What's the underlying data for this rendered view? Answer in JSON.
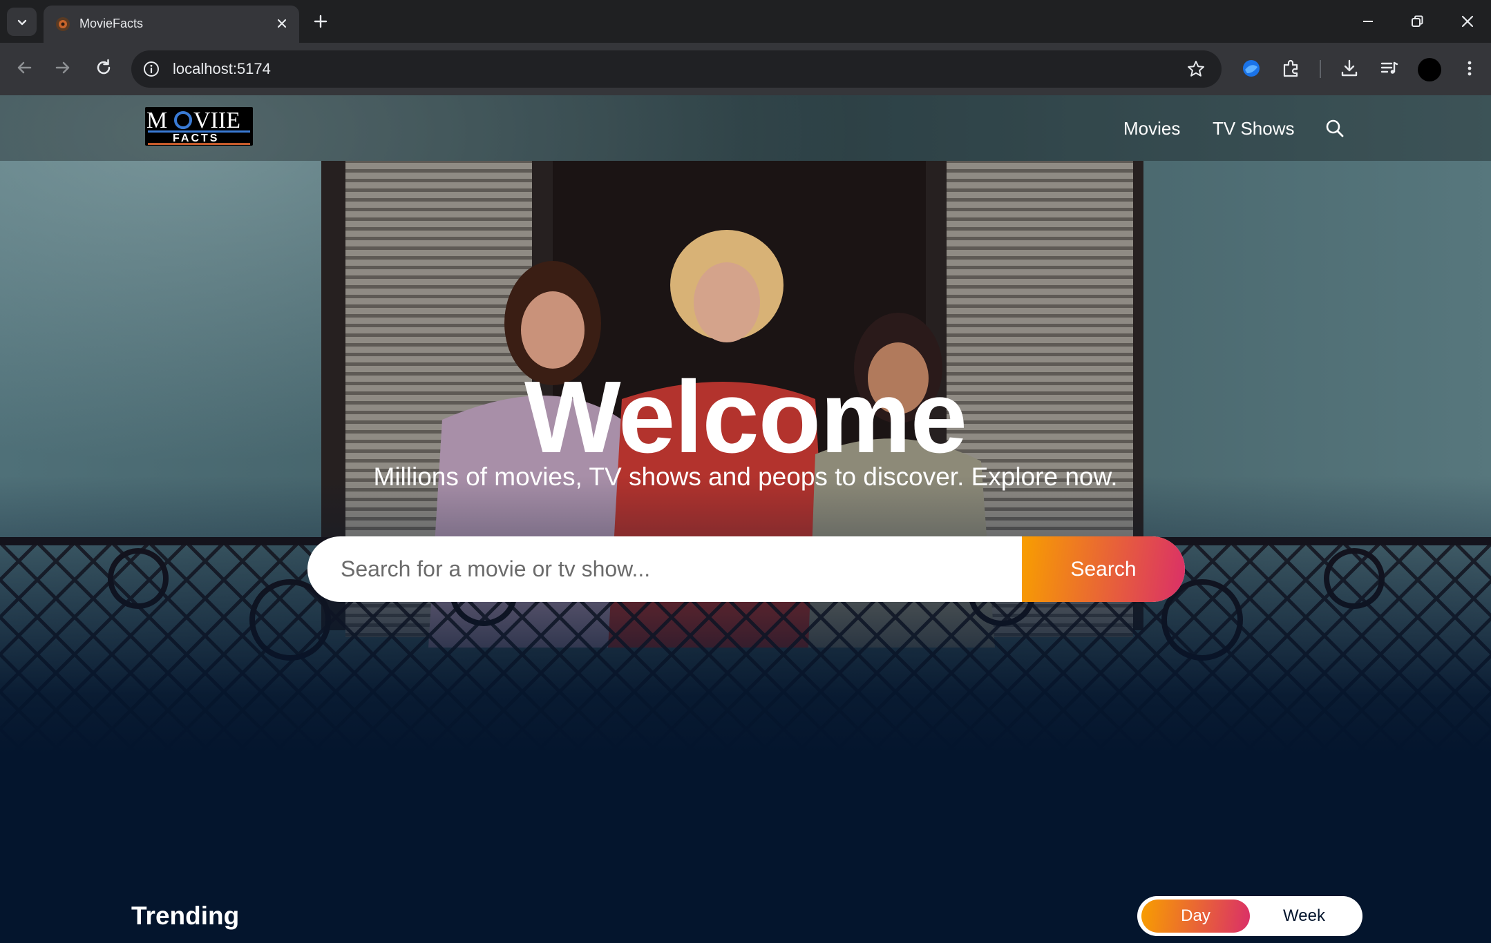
{
  "browser": {
    "tab_title": "MovieFacts",
    "url": "localhost:5174"
  },
  "header": {
    "logo_text": "MOVIIE FACTS",
    "nav": [
      {
        "label": "Movies"
      },
      {
        "label": "TV Shows"
      }
    ]
  },
  "hero": {
    "title": "Welcome",
    "subtitle": "Millions of movies, TV shows and peops to discover. Explore now.",
    "search_placeholder": "Search for a movie or tv show...",
    "search_button": "Search"
  },
  "trending": {
    "title": "Trending",
    "tabs": [
      "Day",
      "Week"
    ],
    "active_tab": "Day"
  },
  "colors": {
    "page_bg": "#04152d",
    "gradient_start": "#f89e00",
    "gradient_end": "#da2f68",
    "chrome_bg": "#1f2022",
    "toolbar_bg": "#35363a"
  }
}
